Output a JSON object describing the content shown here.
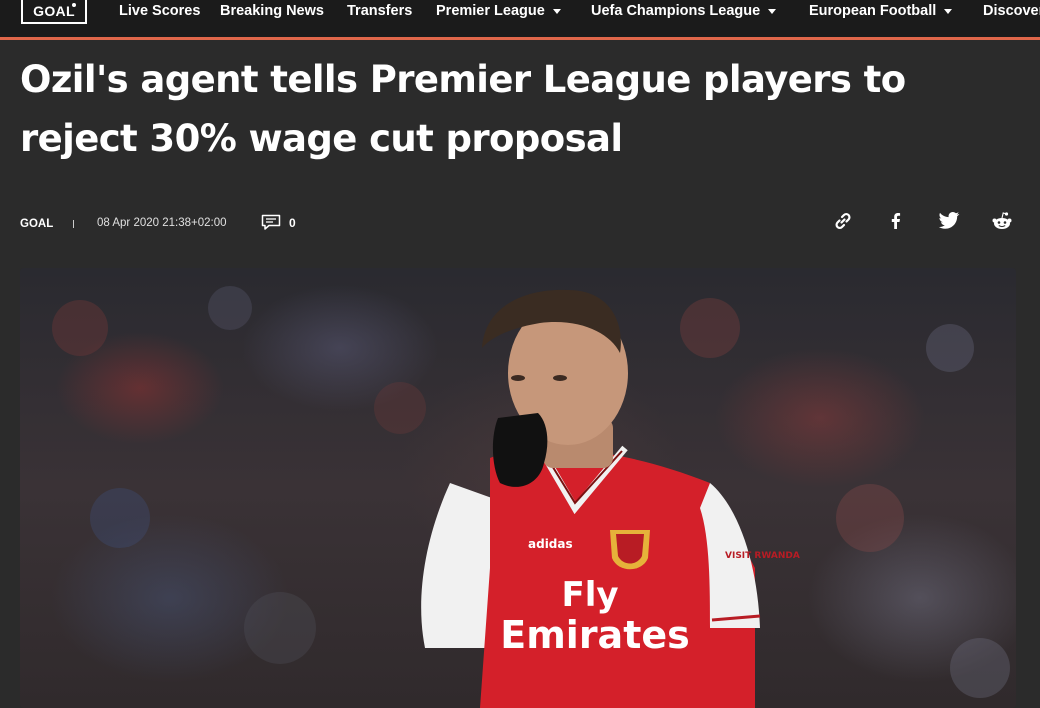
{
  "nav": {
    "logo": "GOAL",
    "items": [
      {
        "label": "Live Scores",
        "dropdown": false
      },
      {
        "label": "Breaking News",
        "dropdown": false
      },
      {
        "label": "Transfers",
        "dropdown": false
      },
      {
        "label": "Premier League",
        "dropdown": true
      },
      {
        "label": "Uefa Champions League",
        "dropdown": true
      },
      {
        "label": "European Football",
        "dropdown": true
      },
      {
        "label": "Discover",
        "dropdown": false
      }
    ],
    "accent_color": "#e0674a"
  },
  "article": {
    "headline": "Ozil's agent tells Premier League players to reject 30% wage cut proposal",
    "source": "GOAL",
    "date": "08 Apr 2020 21:38+02:00",
    "comment_count": "0",
    "share_icons": [
      "link-icon",
      "facebook-icon",
      "twitter-icon",
      "reddit-icon"
    ],
    "hero_image": {
      "shirt_sponsor_line1": "Fly",
      "shirt_sponsor_line2": "Emirates",
      "sleeve_sponsor": "VISIT RWANDA",
      "kit_brand": "adidas"
    }
  }
}
